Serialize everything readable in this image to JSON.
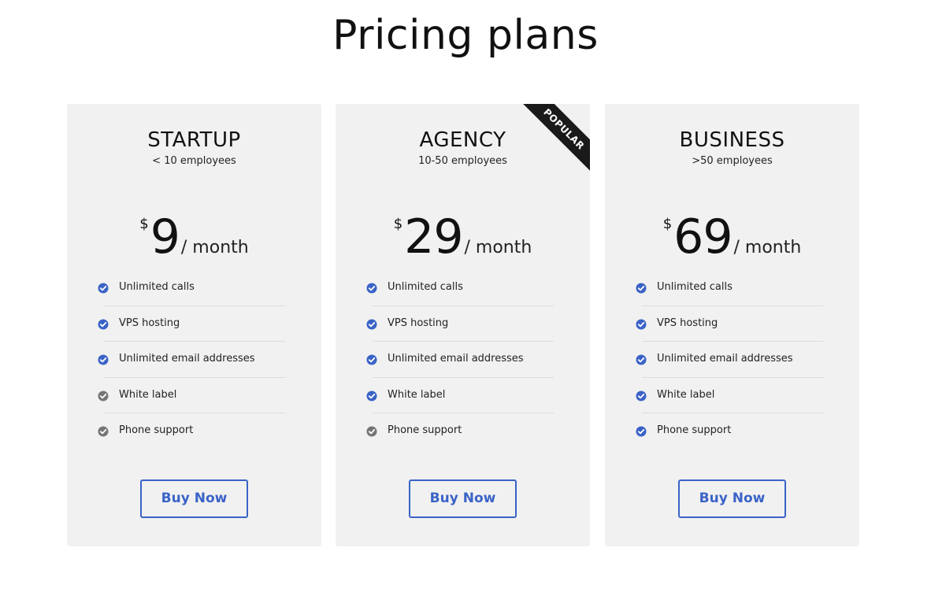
{
  "page_title": "Pricing plans",
  "colors": {
    "accent": "#3a63c7",
    "check_enabled": "#3a63c7",
    "check_disabled": "#757575",
    "card_bg": "#f1f1f1",
    "ribbon_bg": "#1a1a1a"
  },
  "icons": {
    "enabled": "check-circle-icon",
    "disabled": "check-circle-icon (grey)"
  },
  "plans": [
    {
      "name": "STARTUP",
      "employees": "< 10 employees",
      "currency": "$",
      "amount": "9",
      "period": "/ month",
      "button": "Buy Now",
      "badge": "",
      "features": [
        {
          "label": "Unlimited calls",
          "included": true
        },
        {
          "label": "VPS hosting",
          "included": true
        },
        {
          "label": "Unlimited email addresses",
          "included": true
        },
        {
          "label": "White label",
          "included": false
        },
        {
          "label": "Phone support",
          "included": false
        }
      ]
    },
    {
      "name": "AGENCY",
      "employees": "10-50 employees",
      "currency": "$",
      "amount": "29",
      "period": "/ month",
      "button": "Buy Now",
      "badge": "POPULAR",
      "features": [
        {
          "label": "Unlimited calls",
          "included": true
        },
        {
          "label": "VPS hosting",
          "included": true
        },
        {
          "label": "Unlimited email addresses",
          "included": true
        },
        {
          "label": "White label",
          "included": true
        },
        {
          "label": "Phone support",
          "included": false
        }
      ]
    },
    {
      "name": "BUSINESS",
      "employees": ">50 employees",
      "currency": "$",
      "amount": "69",
      "period": "/ month",
      "button": "Buy Now",
      "badge": "",
      "features": [
        {
          "label": "Unlimited calls",
          "included": true
        },
        {
          "label": "VPS hosting",
          "included": true
        },
        {
          "label": "Unlimited email addresses",
          "included": true
        },
        {
          "label": "White label",
          "included": true
        },
        {
          "label": "Phone support",
          "included": true
        }
      ]
    }
  ]
}
